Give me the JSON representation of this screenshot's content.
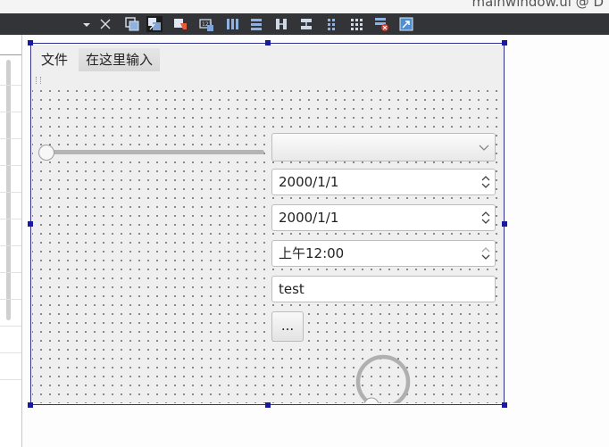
{
  "window": {
    "title": "mainwindow.ui @ D"
  },
  "toolbar": {
    "items": [
      {
        "name": "dropdown-arrow-icon"
      },
      {
        "name": "close-icon"
      },
      {
        "name": "edit-widgets-icon"
      },
      {
        "name": "edit-signals-slots-icon"
      },
      {
        "name": "edit-buddies-icon"
      },
      {
        "name": "edit-tab-order-icon"
      },
      {
        "name": "layout-horizontal-icon"
      },
      {
        "name": "layout-vertical-icon"
      },
      {
        "name": "layout-horizontal-splitter-icon"
      },
      {
        "name": "layout-vertical-splitter-icon"
      },
      {
        "name": "layout-form-icon"
      },
      {
        "name": "layout-grid-icon"
      },
      {
        "name": "break-layout-icon"
      },
      {
        "name": "adjust-size-icon"
      }
    ]
  },
  "form": {
    "menubar": {
      "file": "文件",
      "type_here": "在这里输入"
    },
    "slider": {
      "value": 0
    },
    "combo": {
      "value": ""
    },
    "date_edit_1": {
      "value": "2000/1/1"
    },
    "date_edit_2": {
      "value": "2000/1/1"
    },
    "time_edit": {
      "value": "上午12:00"
    },
    "line_edit": {
      "value": "test"
    },
    "tool_button": {
      "label": "..."
    },
    "dial": {
      "value": 0
    }
  },
  "colors": {
    "selection_handle": "#1a1aa0",
    "toolbar_bg": "#333438",
    "form_bg": "#efeff0"
  }
}
